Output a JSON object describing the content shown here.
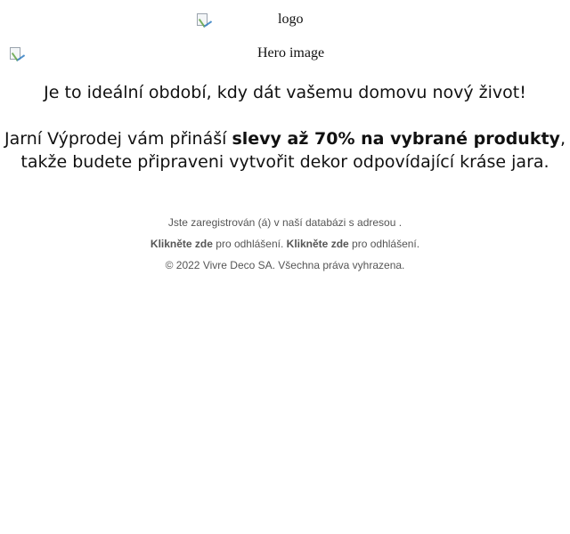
{
  "images": {
    "logo_alt": "logo",
    "hero_alt": "Hero image"
  },
  "content": {
    "intro": "Je to ideální období, kdy dát vašemu domovu nový život!",
    "sale_prefix": "Jarní Výprodej vám přináší ",
    "sale_bold": "slevy až 70% na vybrané produkty",
    "sale_suffix": ",",
    "sale_line2": "takže budete připraveni vytvořit dekor odpovídající kráse jara."
  },
  "footer": {
    "registered_text": "Jste zaregistrován (á) v naší databázi s adresou .",
    "unsubscribe_link_1": "Klikněte zde",
    "unsubscribe_text_1": " pro odhlášení. ",
    "unsubscribe_link_2": "Klikněte zde",
    "unsubscribe_text_2": " pro odhlášení.",
    "copyright": "© 2022 Vivre Deco SA. Všechna práva vyhrazena."
  }
}
